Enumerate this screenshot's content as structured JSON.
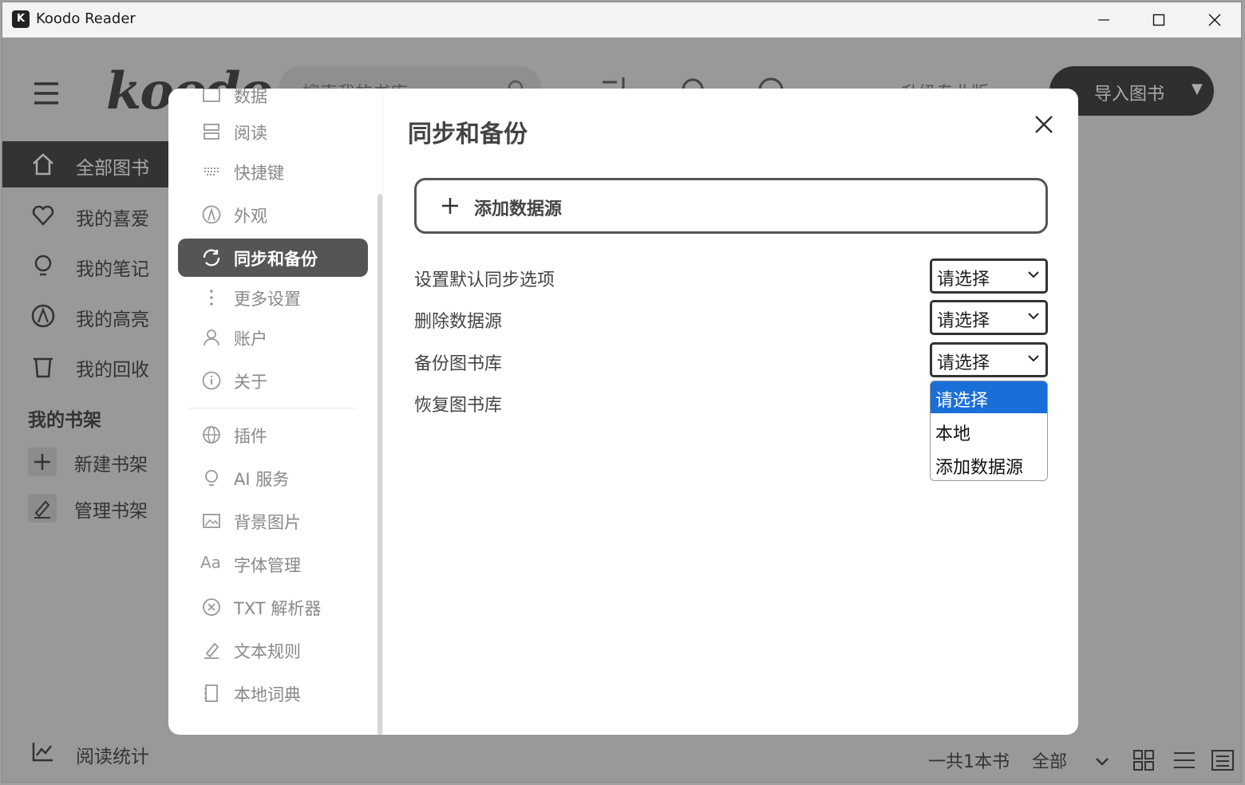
{
  "window": {
    "title": "Koodo Reader"
  },
  "header": {
    "logo": "koodo",
    "search_placeholder": "搜索我的书库",
    "upgrade_label": "升级专业版",
    "import_label": "导入图书"
  },
  "sidebar": {
    "items": [
      {
        "label": "全部图书",
        "icon": "home-icon"
      },
      {
        "label": "我的喜爱",
        "icon": "heart-icon"
      },
      {
        "label": "我的笔记",
        "icon": "bulb-icon"
      },
      {
        "label": "我的高亮",
        "icon": "highlight-icon"
      },
      {
        "label": "我的回收",
        "icon": "trash-icon"
      }
    ],
    "shelf_title": "我的书架",
    "shelf_actions": [
      {
        "label": "新建书架",
        "icon": "plus-icon"
      },
      {
        "label": "管理书架",
        "icon": "edit-icon"
      }
    ],
    "stats_label": "阅读统计"
  },
  "footer": {
    "count": "一共1本书",
    "filter": "全部"
  },
  "settings": {
    "menu": [
      {
        "label": "数据",
        "icon": "data-icon"
      },
      {
        "label": "阅读",
        "icon": "reading-icon"
      },
      {
        "label": "快捷键",
        "icon": "keyboard-icon"
      },
      {
        "label": "外观",
        "icon": "appearance-icon"
      },
      {
        "label": "同步和备份",
        "icon": "sync-icon"
      },
      {
        "label": "更多设置",
        "icon": "more-icon"
      },
      {
        "label": "账户",
        "icon": "user-icon"
      },
      {
        "label": "关于",
        "icon": "info-icon"
      }
    ],
    "menu2": [
      {
        "label": "插件",
        "icon": "globe-icon"
      },
      {
        "label": "AI 服务",
        "icon": "bulb-icon"
      },
      {
        "label": "背景图片",
        "icon": "image-icon"
      },
      {
        "label": "字体管理",
        "icon": "font-icon"
      },
      {
        "label": "TXT 解析器",
        "icon": "parser-icon"
      },
      {
        "label": "文本规则",
        "icon": "edit-icon"
      },
      {
        "label": "本地词典",
        "icon": "dictionary-icon"
      }
    ],
    "active_index": 4,
    "title": "同步和备份",
    "add_source_label": "添加数据源",
    "rows": [
      {
        "label": "设置默认同步选项",
        "value": "请选择"
      },
      {
        "label": "删除数据源",
        "value": "请选择"
      },
      {
        "label": "备份图书库",
        "value": "请选择"
      },
      {
        "label": "恢复图书库"
      }
    ],
    "dropdown_options": [
      "请选择",
      "本地",
      "添加数据源"
    ],
    "dropdown_selected": "请选择"
  }
}
